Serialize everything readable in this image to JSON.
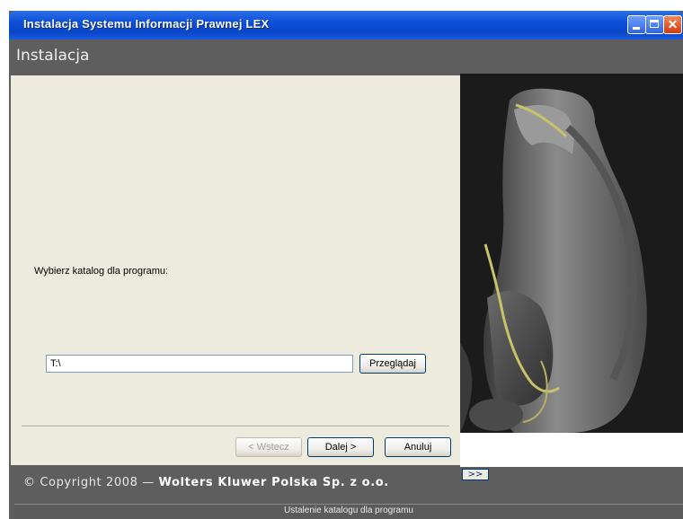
{
  "window": {
    "title": "Instalacja  Systemu Informacji Prawnej LEX",
    "close_glyph": "✕"
  },
  "header": {
    "title": "Instalacja"
  },
  "form": {
    "prompt": "Wybierz katalog dla programu:",
    "path_value": "T:\\",
    "browse_label": "Przeglądaj"
  },
  "nav": {
    "back_label": "< Wstecz",
    "next_label": "Dalej >",
    "cancel_label": "Anuluj"
  },
  "expand": {
    "label": ">>"
  },
  "footer": {
    "copyright_prefix": "© Copyright 2008 — ",
    "company": "Wolters Kluwer Polska Sp. z o.o."
  },
  "status": {
    "text": "Ustalenie katalogu dla programu"
  },
  "colors": {
    "titlebar": "#0b4fd8",
    "band": "#5e5e5e",
    "panel": "#ecebde",
    "accent_line": "#c8c26a"
  },
  "icons": [
    "minimize-icon",
    "maximize-icon",
    "close-icon",
    "decorative-sculpture-image"
  ]
}
